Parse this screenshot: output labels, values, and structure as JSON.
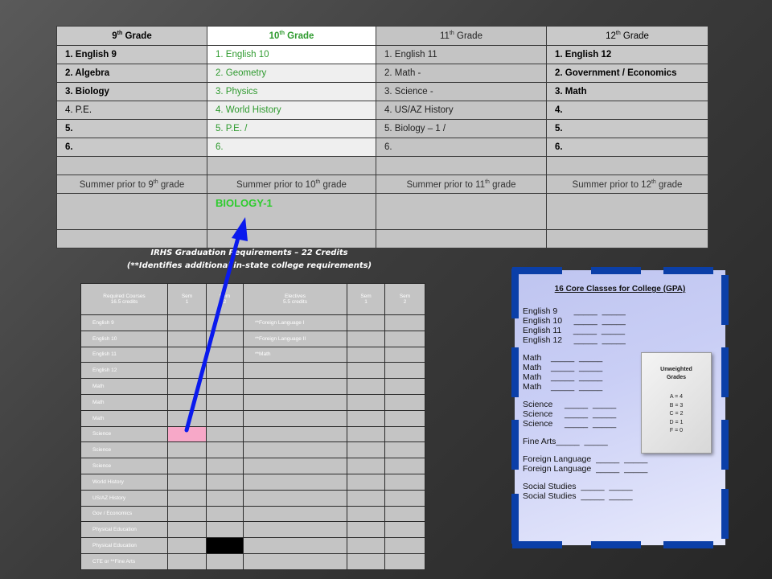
{
  "top_table": {
    "headers": [
      {
        "grade": "9",
        "sup": "th",
        "suffix": " Grade"
      },
      {
        "grade": "10",
        "sup": "th",
        "suffix": " Grade"
      },
      {
        "grade": "11",
        "sup": "th",
        "suffix": " Grade"
      },
      {
        "grade": "12",
        "sup": "th",
        "suffix": " Grade"
      }
    ],
    "rows": [
      [
        "1. English 9",
        "1. English 10",
        "1. English 11",
        "1. English 12"
      ],
      [
        "2. Algebra",
        "2. Geometry",
        "2. Math -",
        "2. Government / Economics"
      ],
      [
        "3. Biology",
        "3. Physics",
        "3. Science -",
        "3. Math"
      ],
      [
        "4. P.E.",
        "4. World History",
        "4. US/AZ History",
        "4."
      ],
      [
        "5.",
        "5. P.E.  /",
        "5. Biology – 1  /",
        "5."
      ],
      [
        "6.",
        "6.",
        "6.",
        "6."
      ]
    ],
    "summers": [
      {
        "pre": "Summer prior to 9",
        "sup": "th",
        "post": " grade"
      },
      {
        "pre": "Summer prior to 10",
        "sup": "th",
        "post": " grade"
      },
      {
        "pre": "Summer prior to 11",
        "sup": "th",
        "post": " grade"
      },
      {
        "pre": "Summer prior to 12",
        "sup": "th",
        "post": " grade"
      }
    ],
    "summer_entry": "BIOLOGY-1"
  },
  "graduation": {
    "title": "IRHS Graduation Requirements – 22 Credits",
    "note": "(**Identifies additional in-state college requirements)"
  },
  "req_table": {
    "headers": {
      "required": "Required Courses",
      "required_credits": "16.5 credits",
      "sem1": "Sem",
      "sem1_num": "1",
      "sem2": "Sem",
      "sem2_num": "2",
      "electives": "Electives",
      "electives_credits": "5.5 credits",
      "esem1": "Sem",
      "esem1_num": "1",
      "esem2": "Sem",
      "esem2_num": "2"
    },
    "rows": [
      {
        "course": "English 9",
        "elective": "**Foreign Language I"
      },
      {
        "course": "English 10",
        "elective": "**Foreign Language II"
      },
      {
        "course": "English 11",
        "elective": "**Math"
      },
      {
        "course": "English 12",
        "elective": ""
      },
      {
        "course": "Math",
        "elective": ""
      },
      {
        "course": "Math",
        "elective": ""
      },
      {
        "course": "Math",
        "elective": ""
      },
      {
        "course": "Science",
        "elective": ""
      },
      {
        "course": "Science",
        "elective": ""
      },
      {
        "course": "Science",
        "elective": ""
      },
      {
        "course": "World History",
        "elective": ""
      },
      {
        "course": "US/AZ History",
        "elective": ""
      },
      {
        "course": "Gov / Economics",
        "elective": ""
      },
      {
        "course": "Physical Education",
        "elective": ""
      },
      {
        "course": "Physical Education",
        "elective": ""
      },
      {
        "course": "CTE or **Fine Arts",
        "elective": ""
      }
    ]
  },
  "core": {
    "title": "16 Core Classes for College (GPA)",
    "lines": [
      "English 9       _____  _____",
      "English 10     _____  _____",
      "English 11     _____  _____",
      "English 12     _____  _____",
      "",
      "Math    _____  _____",
      "Math    _____  _____",
      "Math    _____  _____",
      "Math    _____  _____",
      "",
      "Science     _____  _____",
      "Science     _____  _____",
      "Science     _____  _____",
      "",
      "Fine Arts_____  _____",
      "",
      "Foreign Language  _____  _____",
      "Foreign Language  _____  _____",
      "",
      "Social Studies  _____  _____",
      "Social Studies  _____  _____"
    ]
  },
  "grades": {
    "title_line1": "Unweighted",
    "title_line2": "Grades",
    "items": [
      "A = 4",
      "B = 3",
      "C = 2",
      "D = 1",
      "F = 0"
    ]
  },
  "colors": {
    "arrow": "#0a1aee",
    "tenth_text": "#2e9a2e",
    "summer_entry": "#2ecc2e",
    "card_tab": "#0b3fa8",
    "highlight_pink": "#f7a8c8"
  }
}
